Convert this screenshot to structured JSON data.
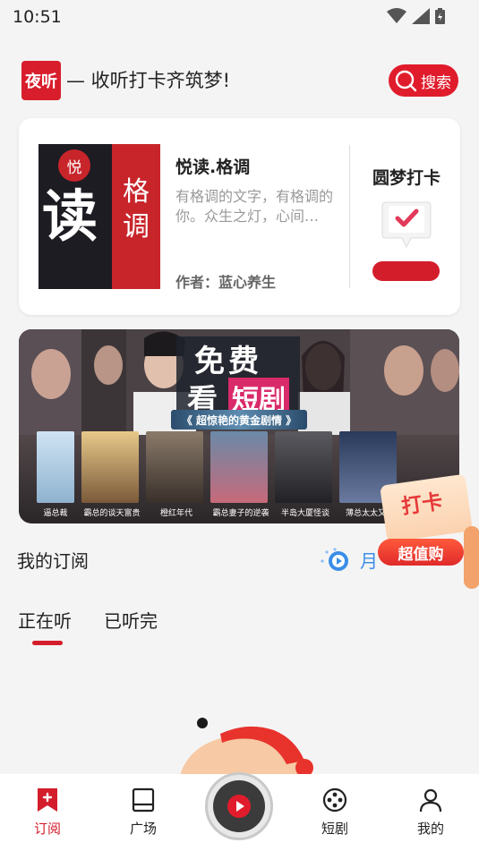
{
  "status_bar": {
    "time": "10:51"
  },
  "header": {
    "logo_text": "夜听",
    "slogan": "— 收听打卡齐筑梦!",
    "search_label": "搜索"
  },
  "featured": {
    "cover_seal": "悦",
    "cover_big": "读",
    "cover_side": "格调",
    "title": "悦读.格调",
    "description": "有格调的文字，有格调的你。众生之灯，心间…",
    "author": "作者：蓝心养生",
    "checkin_title": "圆梦打卡"
  },
  "banner": {
    "title_line1": "免费",
    "title_line2a": "看",
    "title_line2b": "短剧",
    "ribbon": "《 超惊艳的黄金剧情 》",
    "thumbs": [
      "逼总裁",
      "霸总的谈天富贵",
      "橙红年代",
      "霸总妻子的逆袭",
      "半岛大厦怪谈",
      "薄总太太又去"
    ]
  },
  "promo": {
    "line1": "打卡",
    "line2": "超值购"
  },
  "subscription": {
    "title": "我的订阅",
    "more_label": "月"
  },
  "tabs": [
    {
      "label": "正在听"
    },
    {
      "label": "已听完"
    }
  ],
  "bottom_nav": {
    "subscribe": "订阅",
    "plaza": "广场",
    "short_drama": "短剧",
    "mine": "我的"
  },
  "colors": {
    "brand_red": "#d41d2b",
    "link_blue": "#3a8ee8"
  }
}
